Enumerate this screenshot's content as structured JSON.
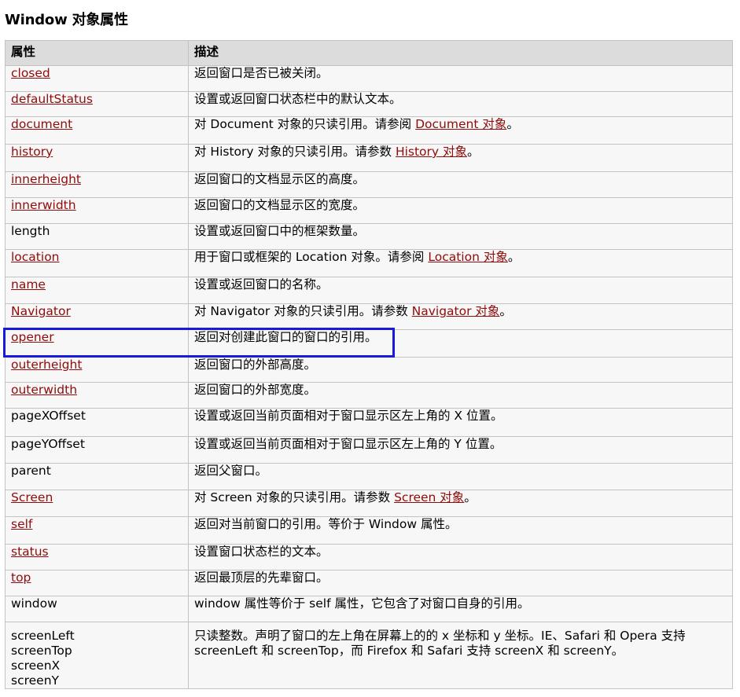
{
  "page_title": "Window 对象属性",
  "table": {
    "headers": [
      "属性",
      "描述"
    ],
    "rows": [
      {
        "name": "closed",
        "link": true,
        "desc": [
          {
            "t": "返回窗口是否已被关闭。"
          }
        ]
      },
      {
        "name": "defaultStatus",
        "link": true,
        "desc": [
          {
            "t": "设置或返回窗口状态栏中的默认文本。"
          }
        ]
      },
      {
        "name": "document",
        "link": true,
        "desc": [
          {
            "t": "对 Document 对象的只读引用。请参阅 "
          },
          {
            "t": "Document 对象",
            "link": true
          },
          {
            "t": "。"
          }
        ]
      },
      {
        "name": "history",
        "link": true,
        "desc": [
          {
            "t": "对 History 对象的只读引用。请参数 "
          },
          {
            "t": "History 对象",
            "link": true
          },
          {
            "t": "。"
          }
        ]
      },
      {
        "name": "innerheight",
        "link": true,
        "desc": [
          {
            "t": "返回窗口的文档显示区的高度。"
          }
        ]
      },
      {
        "name": "innerwidth",
        "link": true,
        "desc": [
          {
            "t": "返回窗口的文档显示区的宽度。"
          }
        ]
      },
      {
        "name": "length",
        "link": false,
        "desc": [
          {
            "t": "设置或返回窗口中的框架数量。"
          }
        ]
      },
      {
        "name": "location",
        "link": true,
        "desc": [
          {
            "t": "用于窗口或框架的 Location 对象。请参阅 "
          },
          {
            "t": "Location 对象",
            "link": true
          },
          {
            "t": "。"
          }
        ]
      },
      {
        "name": "name",
        "link": true,
        "desc": [
          {
            "t": "设置或返回窗口的名称。"
          }
        ]
      },
      {
        "name": "Navigator",
        "link": true,
        "desc": [
          {
            "t": "对 Navigator 对象的只读引用。请参数 "
          },
          {
            "t": "Navigator 对象",
            "link": true
          },
          {
            "t": "。"
          }
        ]
      },
      {
        "name": "opener",
        "link": true,
        "desc": [
          {
            "t": "返回对创建此窗口的窗口的引用。"
          }
        ]
      },
      {
        "name": "outerheight",
        "link": true,
        "desc": [
          {
            "t": "返回窗口的外部高度。"
          }
        ]
      },
      {
        "name": "outerwidth",
        "link": true,
        "desc": [
          {
            "t": "返回窗口的外部宽度。"
          }
        ]
      },
      {
        "name": "pageXOffset",
        "link": false,
        "desc": [
          {
            "t": "设置或返回当前页面相对于窗口显示区左上角的 X 位置。"
          }
        ]
      },
      {
        "name": "pageYOffset",
        "link": false,
        "desc": [
          {
            "t": "设置或返回当前页面相对于窗口显示区左上角的 Y 位置。"
          }
        ]
      },
      {
        "name": "parent",
        "link": false,
        "desc": [
          {
            "t": "返回父窗口。"
          }
        ]
      },
      {
        "name": "Screen",
        "link": true,
        "desc": [
          {
            "t": "对 Screen 对象的只读引用。请参数 "
          },
          {
            "t": "Screen 对象",
            "link": true
          },
          {
            "t": "。"
          }
        ]
      },
      {
        "name": "self",
        "link": true,
        "desc": [
          {
            "t": "返回对当前窗口的引用。等价于 Window 属性。"
          }
        ]
      },
      {
        "name": "status",
        "link": true,
        "desc": [
          {
            "t": "设置窗口状态栏的文本。"
          }
        ]
      },
      {
        "name": "top",
        "link": true,
        "desc": [
          {
            "t": "返回最顶层的先辈窗口。"
          }
        ]
      },
      {
        "name": "window",
        "link": false,
        "desc": [
          {
            "t": "window 属性等价于 self 属性，它包含了对窗口自身的引用。"
          }
        ]
      },
      {
        "names": [
          "screenLeft",
          "screenTop",
          "screenX",
          "screenY"
        ],
        "link": false,
        "desc": [
          {
            "t": "只读整数。声明了窗口的左上角在屏幕上的的 x 坐标和 y 坐标。IE、Safari 和 Opera 支持 screenLeft 和 screenTop，而 Firefox 和 Safari 支持 screenX 和 screenY。"
          }
        ]
      }
    ]
  },
  "highlight": {
    "row": "opener",
    "color": "#1a1adc"
  },
  "colors": {
    "link": "#900b09",
    "header_bg": "#dcdcdc",
    "cell_bg": "#f7f7f7",
    "border": "#c3c3c3"
  }
}
